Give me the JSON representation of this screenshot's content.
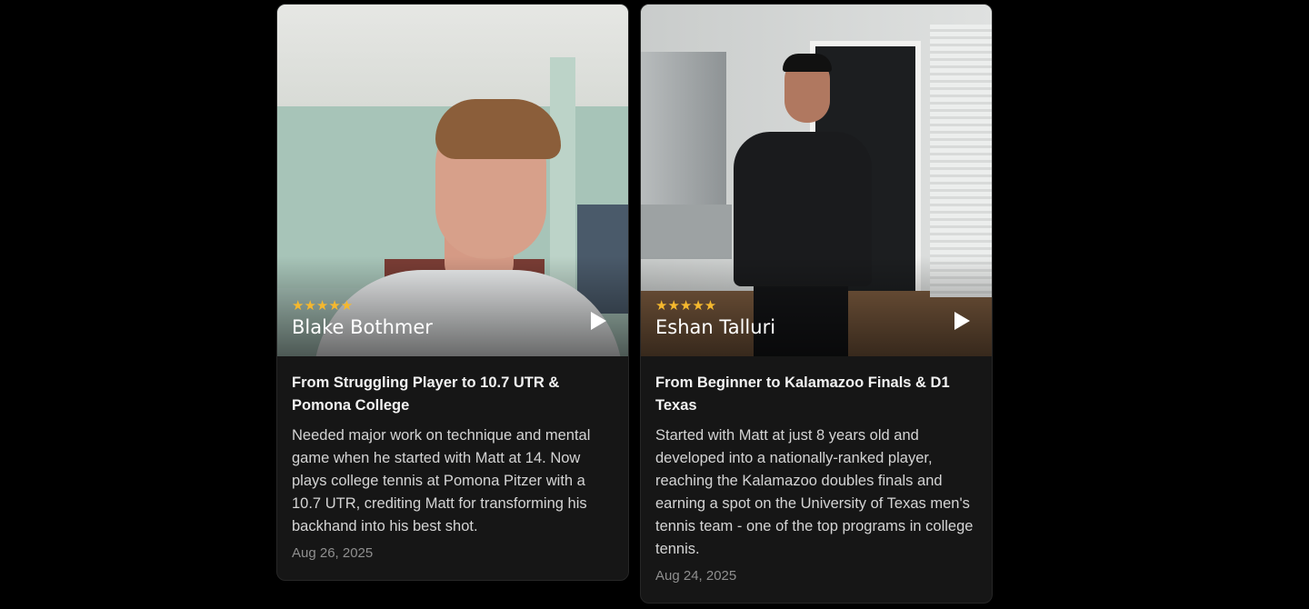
{
  "cards": [
    {
      "rating_stars": "★★★★★",
      "name": "Blake Bothmer",
      "title": "From Struggling Player to 10.7 UTR & Pomona College",
      "description": "Needed major work on technique and mental game when he started with Matt at 14. Now plays college tennis at Pomona Pitzer with a 10.7 UTR, crediting Matt for transforming his backhand into his best shot.",
      "date": "Aug 26, 2025"
    },
    {
      "rating_stars": "★★★★★",
      "name": "Eshan Talluri",
      "title": "From Beginner to Kalamazoo Finals & D1 Texas",
      "description": "Started with Matt at just 8 years old and developed into a nationally-ranked player, reaching the Kalamazoo doubles finals and earning a spot on the University of Texas men's tennis team - one of the top programs in college tennis.",
      "date": "Aug 24, 2025"
    }
  ],
  "icons": {
    "play": "play-icon",
    "star": "star-icon"
  },
  "colors": {
    "background": "#000000",
    "card": "#161616",
    "star": "#f5b82e",
    "date": "#8f8f8f"
  }
}
